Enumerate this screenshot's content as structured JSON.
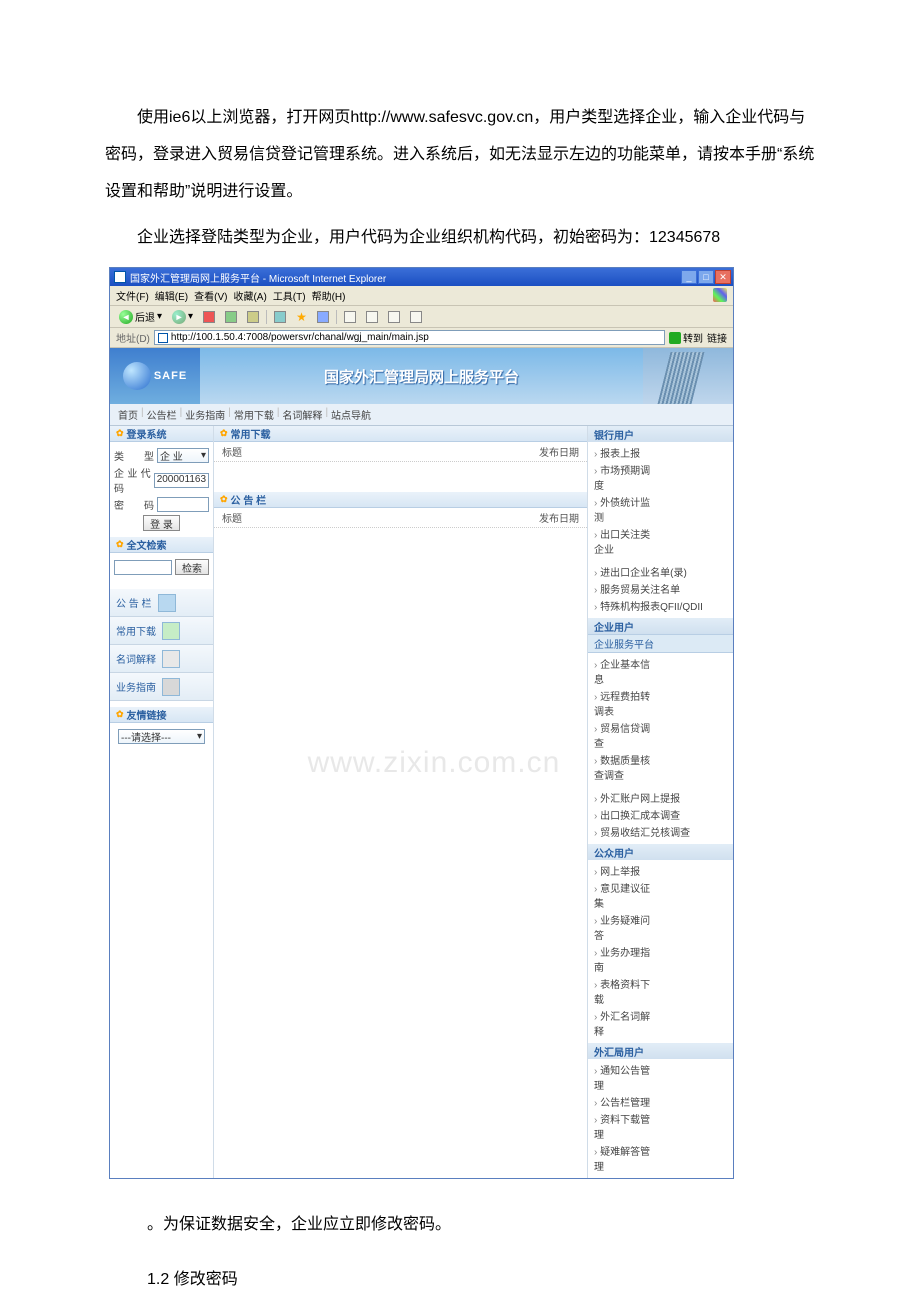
{
  "document": {
    "para1": "使用ie6以上浏览器，打开网页http://www.safesvc.gov.cn，用户类型选择企业，输入企业代码与密码，登录进入贸易信贷登记管理系统。进入系统后，如无法显示左边的功能菜单，请按本手册“系统设置和帮助”说明进行设置。",
    "para2": "企业选择登陆类型为企业，用户代码为企业组织机构代码，初始密码为：12345678",
    "after": "。为保证数据安全，企业应立即修改密码。",
    "sec": "1.2 修改密码"
  },
  "ie": {
    "title": "国家外汇管理局网上服务平台 - Microsoft Internet Explorer",
    "menu": [
      "文件(F)",
      "编辑(E)",
      "查看(V)",
      "收藏(A)",
      "工具(T)",
      "帮助(H)"
    ],
    "back": "后退",
    "addrlabel": "地址(D)",
    "address": "http://100.1.50.4:7008/powersvr/chanal/wgj_main/main.jsp",
    "go": "转到",
    "links": "链接"
  },
  "page": {
    "safe": "SAFE",
    "banner_title": "国家外汇管理局网上服务平台",
    "nav": [
      "首页",
      "公告栏",
      "业务指南",
      "常用下载",
      "名词解释",
      "站点导航"
    ]
  },
  "left": {
    "login_hdr": "登录系统",
    "type_lbl": "类    型",
    "type_val": "企 业",
    "code_lbl": "企业代码",
    "code_val": "200001163",
    "pwd_lbl": "密    码",
    "login_btn": "登  录",
    "search_hdr": "全文检索",
    "search_btn": "检索",
    "tabs": [
      "公 告 栏",
      "常用下载",
      "名词解释",
      "业务指南"
    ],
    "links_hdr": "友情链接",
    "links_ph": "---请选择---"
  },
  "mid": {
    "dl_hdr": "常用下载",
    "col_title": "标题",
    "col_date": "发布日期",
    "notice_hdr": "公 告 栏"
  },
  "right": {
    "bank_hdr": "银行用户",
    "bank_items": [
      "报表上报",
      "市场预期调度",
      "外债统计监测",
      "出口关注类企业",
      "进出口企业名单(录)",
      "服务贸易关注名单",
      "特殊机构报表QFII/QDII"
    ],
    "ent_hdr": "企业用户",
    "ent_sub": "企业服务平台",
    "ent_items": [
      "企业基本信息",
      "远程费拍转调表",
      "贸易信贷调查",
      "数据质量核查调查",
      "外汇账户网上提报",
      "出口换汇成本调查",
      "贸易收结汇兑核调查"
    ],
    "pub_hdr": "公众用户",
    "pub_items": [
      "网上举报",
      "意见建议征集",
      "业务疑难问答",
      "业务办理指南",
      "表格资料下载",
      "外汇名词解释"
    ],
    "adm_hdr": "外汇局用户",
    "adm_items": [
      "通知公告管理",
      "公告栏管理",
      "资料下载管理",
      "疑难解答管理"
    ]
  },
  "watermark": "www.zixin.com.cn"
}
